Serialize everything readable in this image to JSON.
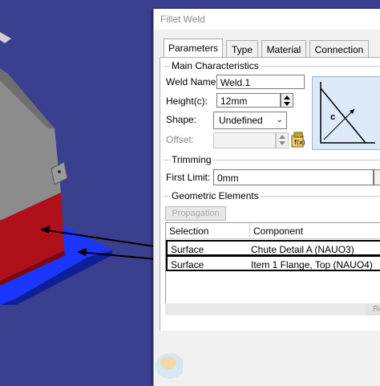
{
  "dialog": {
    "title": "Fillet Weld",
    "tabs": [
      {
        "label": "Parameters",
        "active": true
      },
      {
        "label": "Type",
        "active": false
      },
      {
        "label": "Material",
        "active": false
      },
      {
        "label": "Connection",
        "active": false
      }
    ],
    "main_characteristics": {
      "group_label": "Main Characteristics",
      "weld_name_label": "Weld Name:",
      "weld_name_value": "Weld.1",
      "height_label": "Height(c):",
      "height_value": "12mm",
      "shape_label": "Shape:",
      "shape_value": "Undefined",
      "offset_label": "Offset:",
      "offset_value": "",
      "preview_dimension_label": "c"
    },
    "trimming": {
      "group_label": "Trimming",
      "first_limit_label": "First Limit:",
      "first_limit_value": "0mm"
    },
    "geometric_elements": {
      "group_label": "Geometric Elements",
      "propagation_button": "Propagation",
      "columns": [
        "Selection",
        "Component"
      ],
      "rows": [
        {
          "selection": "Surface",
          "component": "Chute Detail A (NAUO3)"
        },
        {
          "selection": "Surface",
          "component": "Item 1 Flange, Top (NAUO4)"
        }
      ],
      "truncated_button": "Re"
    }
  },
  "colors": {
    "viewport_bg": "#3a3f8f",
    "part_gray": "#8c8c8c",
    "part_red": "#b0101a",
    "flange_blue": "#1a36ff",
    "preview_bg": "#dbe9f8",
    "accent_arrow": "#000000"
  }
}
